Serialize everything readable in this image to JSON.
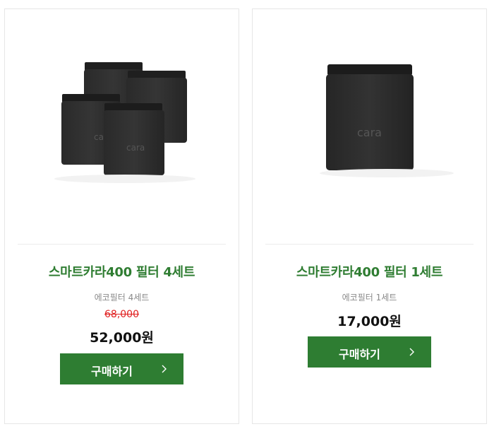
{
  "products": [
    {
      "title": "스마트카라400 필터 4세트",
      "subtitle": "에코필터 4세트",
      "original_price": "68,000",
      "price": "52,000원",
      "buy_label": "구매하기",
      "image_icon": "filter-4set-icon"
    },
    {
      "title": "스마트카라400 필터 1세트",
      "subtitle": "에코필터 1세트",
      "price": "17,000원",
      "buy_label": "구매하기",
      "image_icon": "filter-1set-icon"
    }
  ],
  "colors": {
    "accent_green": "#2e7d32",
    "title_green": "#2f7d32",
    "sale_red": "#e02020",
    "filter_dark": "#2b2b2b"
  }
}
